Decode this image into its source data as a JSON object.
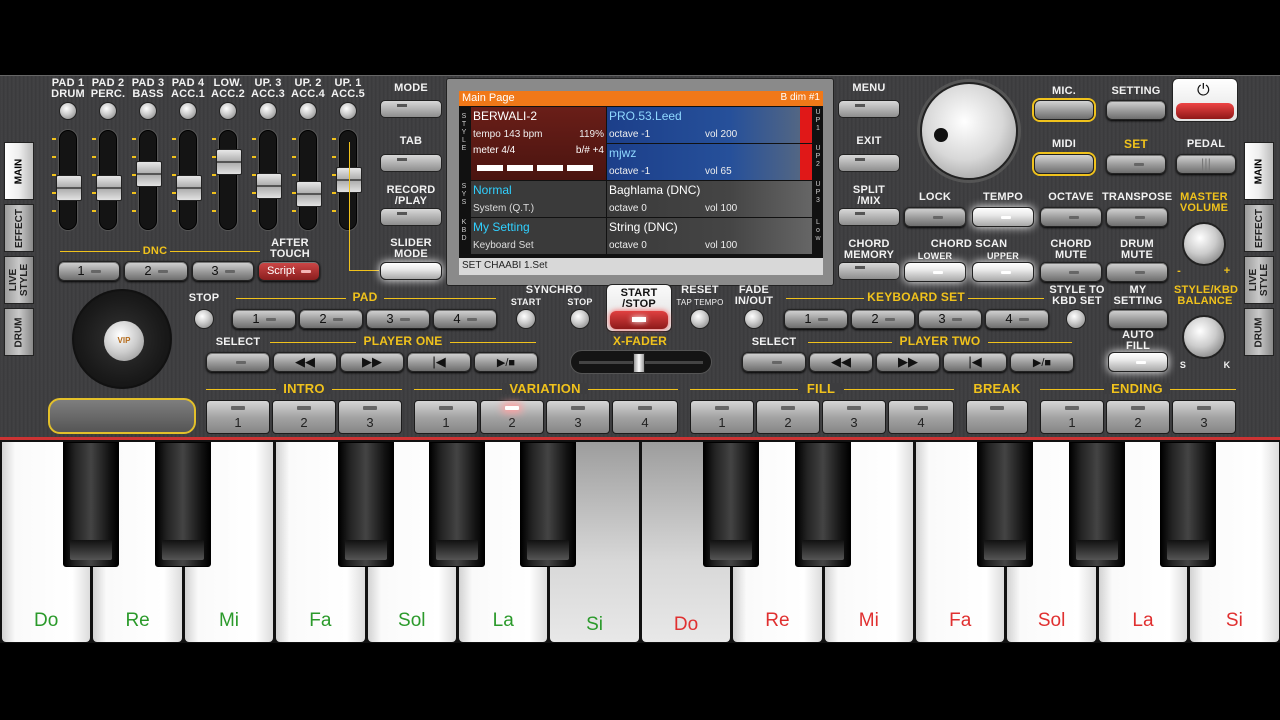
{
  "pads": [
    "PAD 1\nDRUM",
    "PAD 2\nPERC.",
    "PAD 3\nBASS",
    "PAD 4\nACC.1",
    "LOW.\nACC.2",
    "UP. 3\nACC.3",
    "UP. 2\nACC.4",
    "UP. 1\nACC.5"
  ],
  "left_buttons": {
    "mode": "MODE",
    "tab": "TAB",
    "record": "RECORD\n/PLAY",
    "slider": "SLIDER\nMODE"
  },
  "right_buttons": {
    "menu": "MENU",
    "exit": "EXIT",
    "split": "SPLIT\n/MIX",
    "chord_memory": "CHORD\nMEMORY"
  },
  "dnc": {
    "label": "DNC",
    "after_touch": "AFTER\nTOUCH",
    "b1": "1",
    "b2": "2",
    "b3": "3",
    "script": "Script"
  },
  "side_tabs_left": [
    "MAIN",
    "EFFECT",
    "LIVE\nSTYLE",
    "DRUM"
  ],
  "side_tabs_right": [
    "MAIN",
    "EFFECT",
    "LIVE\nSTYLE",
    "DRUM"
  ],
  "top_right": {
    "mic": "MIC.",
    "setting": "SETTING",
    "midi": "MIDI",
    "set": "SET",
    "pedal": "PEDAL"
  },
  "row2": {
    "lock": "LOCK",
    "tempo": "TEMPO",
    "octave": "OCTAVE",
    "transpose": "TRANSPOSE",
    "master_volume": "MASTER\nVOLUME",
    "chord_scan": "CHORD SCAN",
    "lower": "LOWER",
    "upper": "UPPER",
    "chord_mute": "CHORD\nMUTE",
    "drum_mute": "DRUM\nMUTE"
  },
  "screen": {
    "title": "Main Page",
    "chord": "B dim #1",
    "style_name": "BERWALI-2",
    "tempo": "tempo 143 bpm",
    "pct": "119%",
    "meter": "meter 4/4",
    "bsharp": "b/# +4",
    "up1_name": "PRO.53.Leed",
    "up1_oct": "octave -1",
    "up1_vol": "vol 200",
    "up2_name": "mjwz",
    "up2_oct": "octave -1",
    "up2_vol": "vol 65",
    "sys_name": "Normal",
    "sys_sub": "System (Q.T.)",
    "up3_name": "Baghlama (DNC)",
    "up3_oct": "octave  0",
    "up3_vol": "vol 100",
    "kbd_name": "My Setting",
    "kbd_sub": "Keyboard Set",
    "low_name": "String (DNC)",
    "low_oct": "octave  0",
    "low_vol": "vol 100",
    "footer": "SET CHAABI 1.Set",
    "l_style": "S\nT\nY\nL\nE",
    "l_sys": "S\nY\nS",
    "l_kbd": "K\nB\nD",
    "r_up1": "U\nP\n1",
    "r_up2": "U\nP\n2",
    "r_up3": "U\nP\n3",
    "r_low": "L\no\nw"
  },
  "middle": {
    "stop": "STOP",
    "pad": "PAD",
    "synchro": "SYNCHRO",
    "start": "START",
    "stop2": "STOP",
    "start_stop": "START\n/STOP",
    "reset": "RESET",
    "tap_tempo": "TAP TEMPO",
    "fade": "FADE\nIN/OUT",
    "keyboard_set": "KEYBOARD SET",
    "style_to_kbd": "STYLE TO\nKBD SET",
    "my_setting": "MY\nSETTING",
    "balance": "STYLE/KBD\nBALANCE",
    "auto_fill": "AUTO\nFILL",
    "s": "S",
    "k": "K",
    "minus": "-",
    "plus": "+"
  },
  "pad_btns": [
    "1",
    "2",
    "3",
    "4"
  ],
  "kbd_btns": [
    "1",
    "2",
    "3",
    "4"
  ],
  "player": {
    "select": "SELECT",
    "player_one": "PLAYER ONE",
    "player_two": "PLAYER TWO",
    "xfader": "X-FADER",
    "select2": "SELECT"
  },
  "sections": {
    "intro": "INTRO",
    "variation": "VARIATION",
    "fill": "FILL",
    "break": "BREAK",
    "ending": "ENDING"
  },
  "intro_btns": [
    "1",
    "2",
    "3"
  ],
  "variation_btns": [
    "1",
    "2",
    "3",
    "4"
  ],
  "fill_btns": [
    "1",
    "2",
    "3",
    "4"
  ],
  "ending_btns": [
    "1",
    "2",
    "3"
  ],
  "vip": "VIP",
  "white_keys": [
    {
      "label": "Do",
      "color": "#2b9a2b"
    },
    {
      "label": "Re",
      "color": "#2b9a2b"
    },
    {
      "label": "Mi",
      "color": "#2b9a2b"
    },
    {
      "label": "Fa",
      "color": "#2b9a2b"
    },
    {
      "label": "Sol",
      "color": "#2b9a2b"
    },
    {
      "label": "La",
      "color": "#2b9a2b"
    },
    {
      "label": "Si",
      "color": "#2b9a2b"
    },
    {
      "label": "Do",
      "color": "#e03030"
    },
    {
      "label": "Re",
      "color": "#e03030"
    },
    {
      "label": "Mi",
      "color": "#e03030"
    },
    {
      "label": "Fa",
      "color": "#e03030"
    },
    {
      "label": "Sol",
      "color": "#e03030"
    },
    {
      "label": "La",
      "color": "#e03030"
    },
    {
      "label": "Si",
      "color": "#e03030"
    }
  ],
  "colors": {
    "accent": "#f0c21c",
    "record_red": "#c0282a",
    "screen_blue": "#1c3f8a",
    "screen_red": "#5c1a16"
  }
}
